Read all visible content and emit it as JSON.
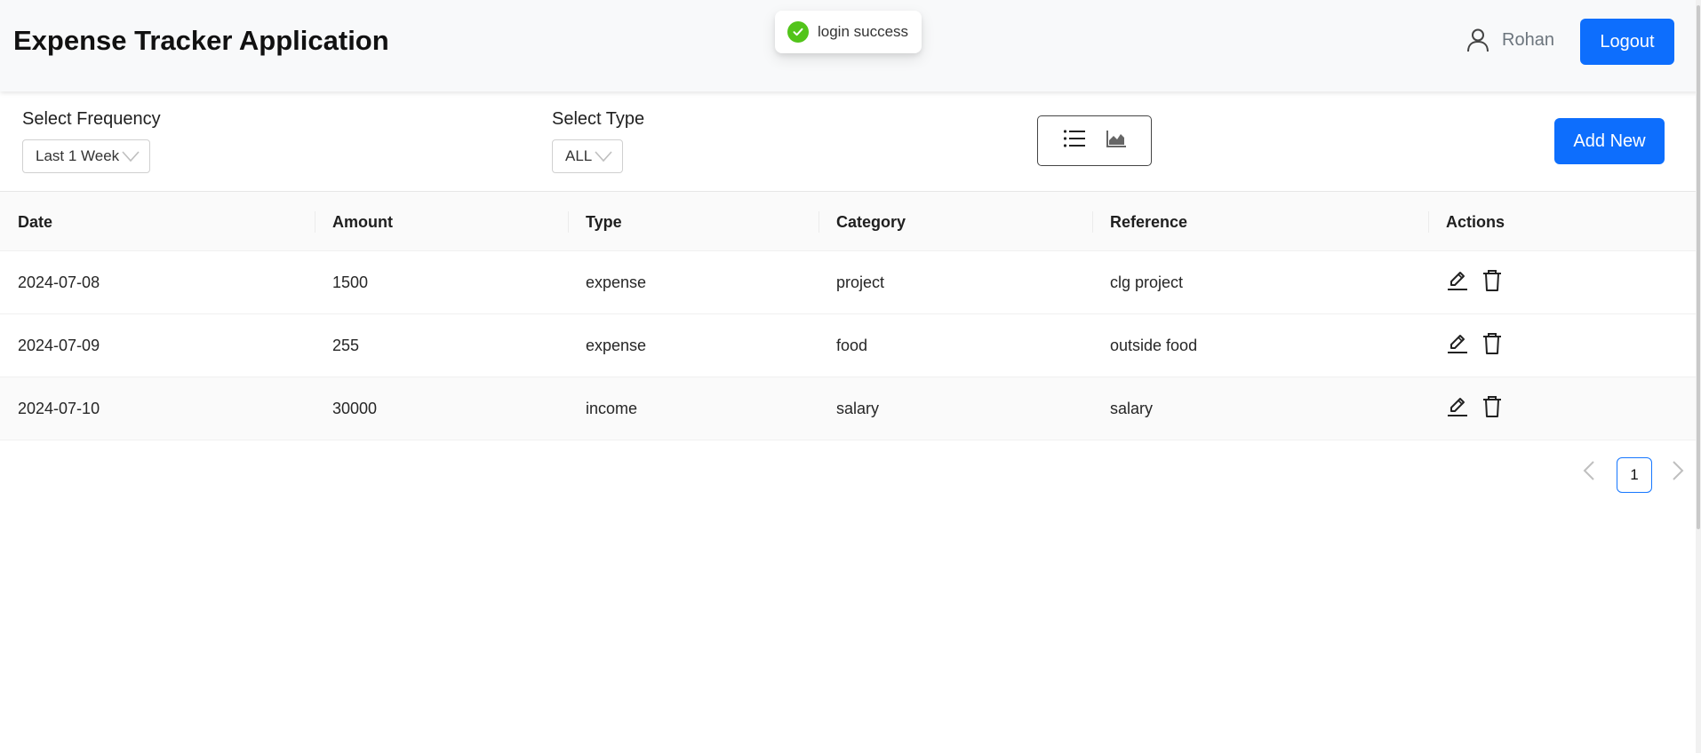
{
  "header": {
    "title": "Expense Tracker Application",
    "username": "Rohan",
    "logout_label": "Logout"
  },
  "toast": {
    "message": "login success",
    "status_color": "#52c41a"
  },
  "filters": {
    "frequency_label": "Select Frequency",
    "frequency_value": "Last 1 Week",
    "type_label": "Select Type",
    "type_value": "ALL",
    "view_icons": [
      "list-icon",
      "area-chart-icon"
    ],
    "add_label": "Add New"
  },
  "table": {
    "columns": [
      "Date",
      "Amount",
      "Type",
      "Category",
      "Reference",
      "Actions"
    ],
    "rows": [
      {
        "date": "2024-07-08",
        "amount": "1500",
        "type": "expense",
        "category": "project",
        "reference": "clg project"
      },
      {
        "date": "2024-07-09",
        "amount": "255",
        "type": "expense",
        "category": "food",
        "reference": "outside food"
      },
      {
        "date": "2024-07-10",
        "amount": "30000",
        "type": "income",
        "category": "salary",
        "reference": "salary"
      }
    ],
    "row_actions": [
      "edit-icon",
      "delete-icon"
    ]
  },
  "pagination": {
    "current_page": "1"
  },
  "colors": {
    "primary": "#0d6efd",
    "header_bg": "#f8f9fa",
    "page_border": "#1677ff"
  }
}
